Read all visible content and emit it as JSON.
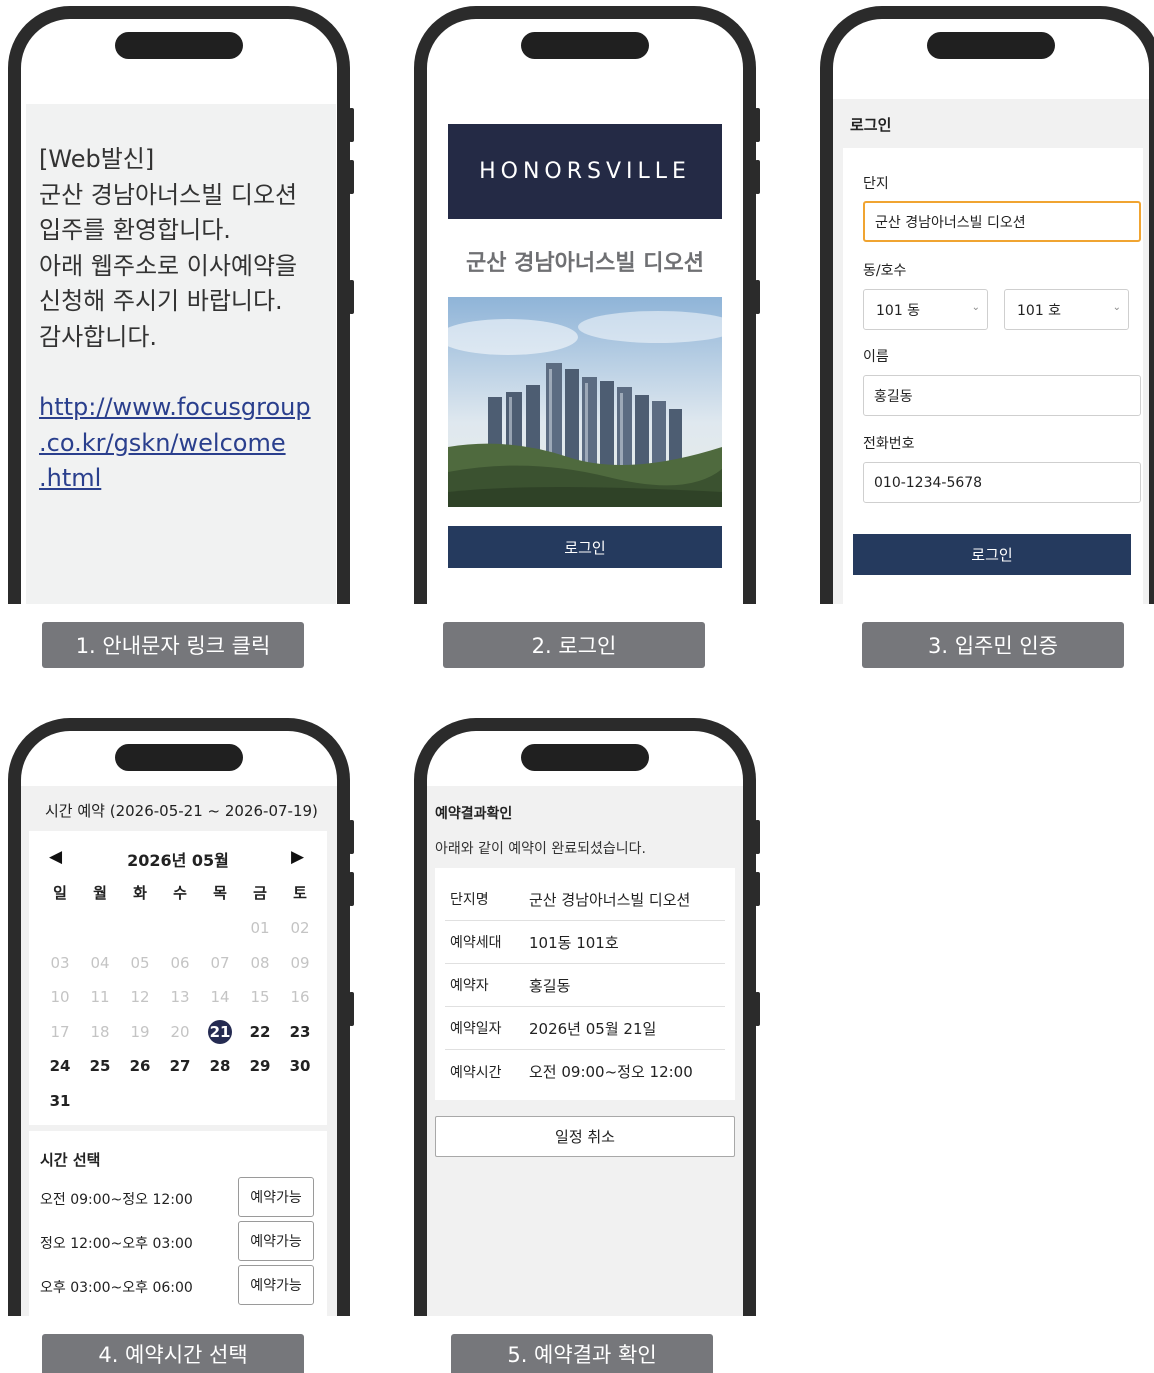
{
  "screen1": {
    "lines": [
      "[Web발신]",
      "군산 경남아너스빌 디오션",
      "입주를 환영합니다.",
      "아래 웹주소로 이사예약을",
      "신청해 주시기 바랍니다.",
      "감사합니다."
    ],
    "link_lines": [
      "http://www.focusgroup",
      ".co.kr/gskn/welcome",
      ".html"
    ],
    "caption": "1. 안내문자 링크 클릭"
  },
  "screen2": {
    "logo": "HONORSVILLE",
    "title": "군산 경남아너스빌 디오션",
    "login_button": "로그인",
    "caption": "2. 로그인"
  },
  "screen3": {
    "header": "로그인",
    "complex_label": "단지",
    "complex_value": "군산 경남아너스빌 디오션",
    "unit_label": "동/호수",
    "dong_value": "101 동",
    "ho_value": "101 호",
    "name_label": "이름",
    "name_value": "홍길동",
    "phone_label": "전화번호",
    "phone_value": "010-1234-5678",
    "login_button": "로그인",
    "caption": "3. 입주민 인증"
  },
  "screen4": {
    "header": "시간 예약 (2026-05-21 ~ 2026-07-19)",
    "prev": "◀",
    "next": "▶",
    "month": "2026년 05월",
    "weekdays": [
      "일",
      "월",
      "화",
      "수",
      "목",
      "금",
      "토"
    ],
    "selected_day": "21",
    "days": [
      [
        "",
        "",
        "",
        "",
        "",
        "01",
        "02"
      ],
      [
        "03",
        "04",
        "05",
        "06",
        "07",
        "08",
        "09"
      ],
      [
        "10",
        "11",
        "12",
        "13",
        "14",
        "15",
        "16"
      ],
      [
        "17",
        "18",
        "19",
        "20",
        "21",
        "22",
        "23"
      ],
      [
        "24",
        "25",
        "26",
        "27",
        "28",
        "29",
        "30"
      ],
      [
        "31",
        "",
        "",
        "",
        "",
        "",
        ""
      ]
    ],
    "time_title": "시간 선택",
    "slots": [
      {
        "label": "오전 09:00~정오 12:00",
        "button": "예약가능"
      },
      {
        "label": "정오 12:00~오후 03:00",
        "button": "예약가능"
      },
      {
        "label": "오후 03:00~오후 06:00",
        "button": "예약가능"
      }
    ],
    "caption": "4. 예약시간 선택"
  },
  "screen5": {
    "header": "예약결과확인",
    "subtitle": "아래와 같이 예약이 완료되셨습니다.",
    "rows": [
      {
        "key": "단지명",
        "value": "군산 경남아너스빌 디오션"
      },
      {
        "key": "예약세대",
        "value": "101동 101호"
      },
      {
        "key": "예약자",
        "value": "홍길동"
      },
      {
        "key": "예약일자",
        "value": "2026년 05월 21일"
      },
      {
        "key": "예약시간",
        "value": "오전 09:00~정오 12:00"
      }
    ],
    "cancel_button": "일정 취소",
    "caption": "5. 예약결과 확인"
  }
}
